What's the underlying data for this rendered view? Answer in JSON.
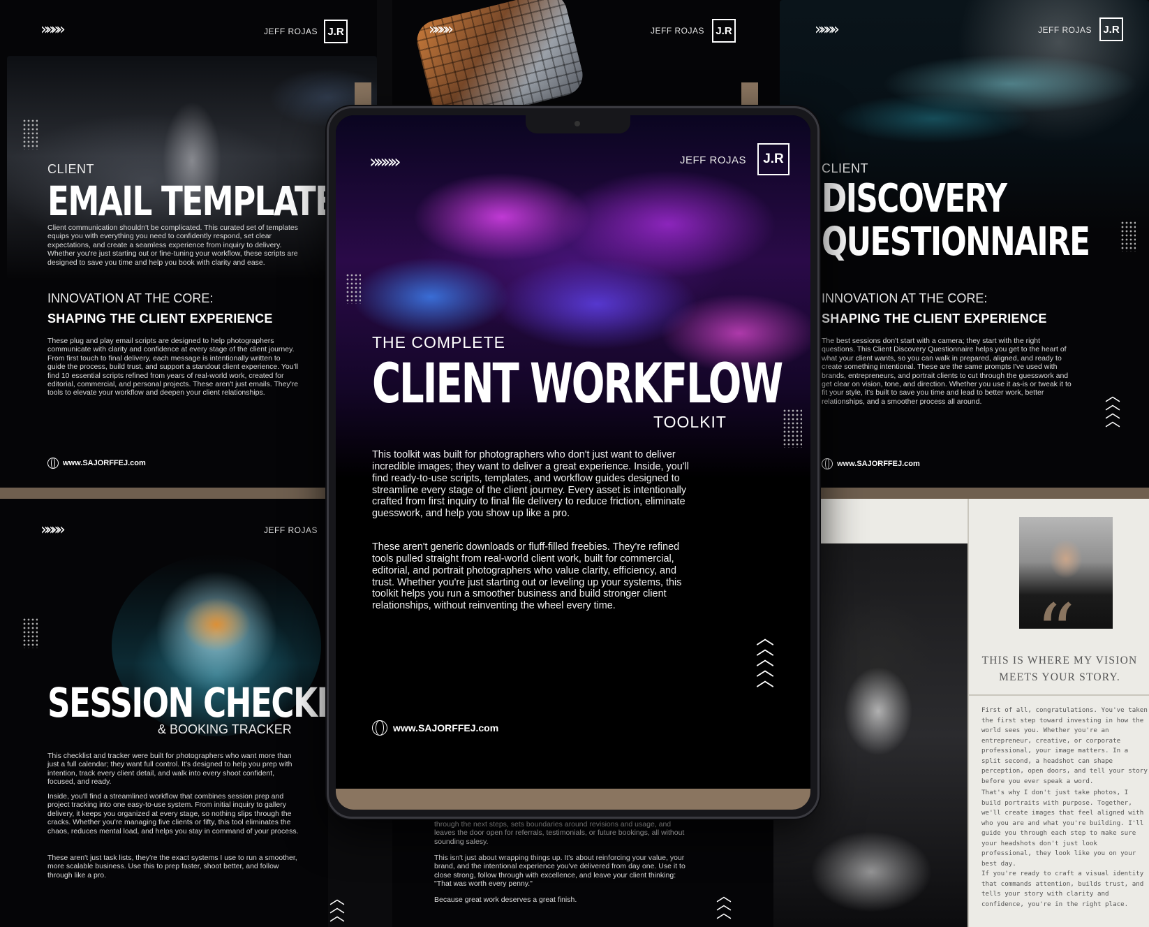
{
  "brand": {
    "name": "JEFF ROJAS",
    "logo_text": "J.R",
    "website": "www.SAJORFFEJ.com",
    "arrows_glyph": "»»»»"
  },
  "email_templates": {
    "kicker": "CLIENT",
    "title": "EMAIL TEMPLATES",
    "intro": "Client communication shouldn't be complicated. This curated set of templates equips you with everything you need to confidently respond, set clear expectations, and create a seamless experience from inquiry to delivery. Whether you're just starting out or fine-tuning your workflow, these scripts are designed to save you time and help you book with clarity and ease.",
    "sub_title": "INNOVATION AT THE CORE:",
    "sub_bold": "SHAPING THE CLIENT EXPERIENCE",
    "body": "These plug and play email scripts are designed to help photographers communicate with clarity and confidence at every stage of the client journey. From first touch to final delivery, each message is intentionally written to guide the process, build trust, and support a standout client experience. You'll find 10 essential scripts refined from years of real-world work, created for editorial, commercial, and personal projects. These aren't just emails. They're tools to elevate your workflow and deepen your client relationships."
  },
  "discovery": {
    "kicker": "CLIENT",
    "title_line1": "DISCOVERY",
    "title_line2": "QUESTIONNAIRE",
    "sub_title": "INNOVATION AT THE CORE:",
    "sub_bold": "SHAPING THE CLIENT EXPERIENCE",
    "body": "The best sessions don't start with a camera; they start with the right questions. This Client Discovery Questionnaire helps you get to the heart of what your client wants, so you can walk in prepared, aligned, and ready to create something intentional. These are the same prompts I've used with brands, entrepreneurs, and portrait clients to cut through the guesswork and get clear on vision, tone, and direction. Whether you use it as-is or tweak it to fit your style, it's built to save you time and lead to better work, better relationships, and a smoother process all around."
  },
  "session": {
    "title": "SESSION CHECKLIST",
    "subtitle": "& BOOKING TRACKER",
    "p1": "This checklist and tracker were built for photographers who want more than just a full calendar; they want full control. It's designed to help you prep with intention, track every client detail, and walk into every shoot confident, focused, and ready.",
    "p2": "Inside, you'll find a streamlined workflow that combines session prep and project tracking into one easy-to-use system. From initial inquiry to gallery delivery, it keeps you organized at every stage, so nothing slips through the cracks. Whether you're managing five clients or fifty, this tool eliminates the chaos, reduces mental load, and helps you stay in command of your process.",
    "p3": "These aren't just task lists, they're the exact systems I use to run a smoother, more scalable business. Use this to prep faster, shoot better, and follow through like a pro."
  },
  "wrap": {
    "p1": "through the next steps, sets boundaries around revisions and usage, and leaves the door open for referrals, testimonials, or future bookings, all without sounding salesy.",
    "p2": "This isn't just about wrapping things up. It's about reinforcing your value, your brand, and the intentional experience you've delivered from day one. Use it to close strong, follow through with excellence, and leave your client thinking: \"That was worth every penny.\"",
    "p3": "Because great work deserves a great finish."
  },
  "tablet": {
    "kicker": "THE COMPLETE",
    "title": "CLIENT WORKFLOW",
    "toolkit": "TOOLKIT",
    "p1": "This toolkit was built for photographers who don't just want to deliver incredible images; they want to deliver a great experience. Inside, you'll find ready-to-use scripts, templates, and workflow guides designed to streamline every stage of the client journey. Every asset is intentionally crafted from first inquiry to final file delivery to reduce friction, eliminate guesswork, and help you show up like a pro.",
    "p2": "These aren't generic downloads or fluff-filled freebies. They're refined tools pulled straight from real-world client work, built for commercial, editorial, and portrait photographers who value clarity, efficiency, and trust. Whether you're just starting out or leveling up your systems, this toolkit helps you run a smoother business and build stronger client relationships, without reinventing the wheel every time."
  },
  "welcome": {
    "quote_line1": "THIS IS WHERE MY VISION",
    "quote_line2": "MEETS YOUR STORY.",
    "p1": "First of all, congratulations. You've taken the first step toward investing in how the world sees you. Whether you're an entrepreneur, creative, or corporate professional, your image matters. In a split second, a headshot can shape perception, open doors, and tell your story before you ever speak a word.",
    "p2": "That's why I don't just take photos, I build portraits with purpose. Together, we'll create images that feel aligned with who you are and what you're building. I'll guide you through each step to make sure your headshots don't just look professional, they look like you on your best day.",
    "p3": "If you're ready to craft a visual identity that commands attention, builds trust, and tells your story with clarity and confidence, you're in the right place."
  },
  "colors": {
    "accent_tan": "#8a7560",
    "panel_bg": "#050507",
    "paper": "#ecebe6"
  }
}
